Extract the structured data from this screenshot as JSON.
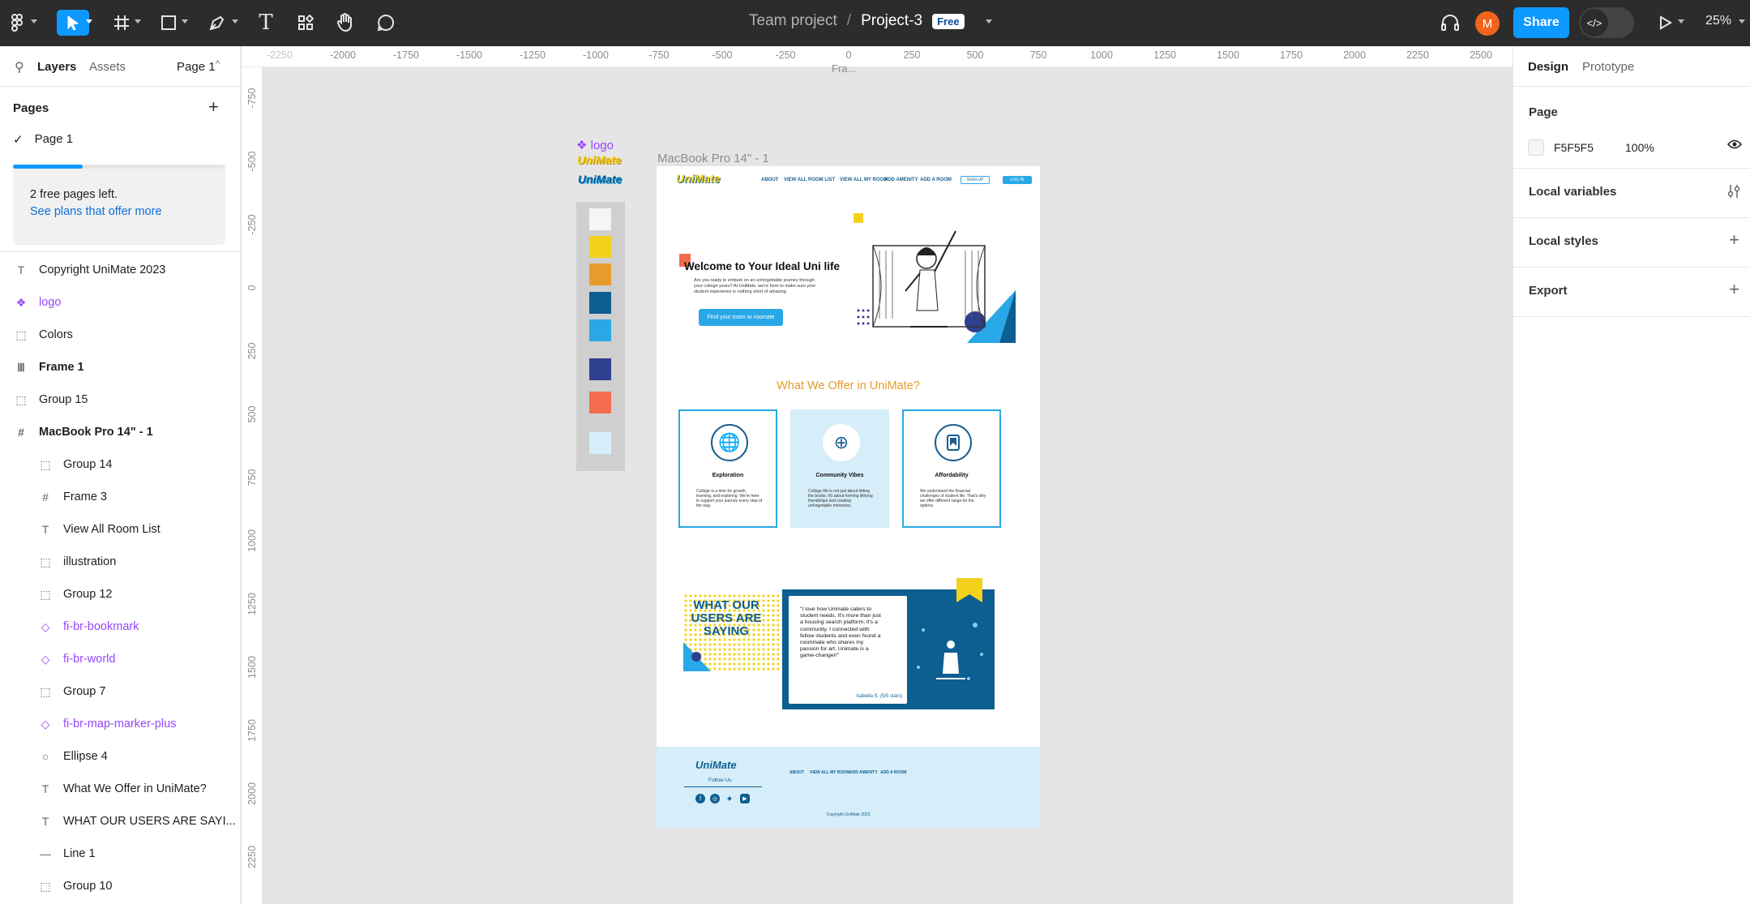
{
  "toolbar": {
    "team": "Team project",
    "separator": "/",
    "project": "Project-3",
    "badge": "Free",
    "share": "Share",
    "avatar_initial": "M",
    "zoom": "25%",
    "dev_mode_icon": "</>"
  },
  "left_panel": {
    "tab_layers": "Layers",
    "tab_assets": "Assets",
    "page_selector": "Page 1",
    "pages_heading": "Pages",
    "current_page": "Page 1",
    "free_pages_progress": 0.33,
    "free_pages_text": "2 free pages left.",
    "plans_link": "See plans that offer more",
    "layers": [
      {
        "name": "Copyright UniMate 2023",
        "icon": "T",
        "kind": "text"
      },
      {
        "name": "logo",
        "icon": "❖",
        "kind": "component"
      },
      {
        "name": "Colors",
        "icon": "⬚",
        "kind": "group"
      },
      {
        "name": "Frame 1",
        "icon": "Ⅲ",
        "kind": "frame"
      },
      {
        "name": "Group 15",
        "icon": "⬚",
        "kind": "group"
      },
      {
        "name": "MacBook Pro 14\" - 1",
        "icon": "#",
        "kind": "frame"
      },
      {
        "name": "Group 14",
        "icon": "⬚",
        "kind": "child-group"
      },
      {
        "name": "Frame 3",
        "icon": "#",
        "kind": "child-group"
      },
      {
        "name": "View All Room List",
        "icon": "T",
        "kind": "child-group"
      },
      {
        "name": "illustration",
        "icon": "⬚",
        "kind": "child-group"
      },
      {
        "name": "Group 12",
        "icon": "⬚",
        "kind": "child-group"
      },
      {
        "name": "fi-br-bookmark",
        "icon": "◇",
        "kind": "child-component"
      },
      {
        "name": "fi-br-world",
        "icon": "◇",
        "kind": "child-component"
      },
      {
        "name": "Group 7",
        "icon": "⬚",
        "kind": "child-group"
      },
      {
        "name": "fi-br-map-marker-plus",
        "icon": "◇",
        "kind": "child-component"
      },
      {
        "name": "Ellipse 4",
        "icon": "○",
        "kind": "child-group"
      },
      {
        "name": "What We Offer in UniMate?",
        "icon": "T",
        "kind": "child-group"
      },
      {
        "name": "WHAT OUR USERS ARE SAYI...",
        "icon": "T",
        "kind": "child-group"
      },
      {
        "name": "Line 1",
        "icon": "—",
        "kind": "child-group"
      },
      {
        "name": "Group 10",
        "icon": "⬚",
        "kind": "child-group"
      }
    ]
  },
  "rulers": {
    "horizontal": [
      "-2250",
      "-2000",
      "-1750",
      "-1500",
      "-1250",
      "-1000",
      "-750",
      "-500",
      "-250",
      "0",
      "250",
      "500",
      "750",
      "1000",
      "1250",
      "1500",
      "1750",
      "2000",
      "2250",
      "2500"
    ],
    "vertical": [
      "-750",
      "-500",
      "-250",
      "0",
      "250",
      "500",
      "750",
      "1000",
      "1250",
      "1500",
      "1750",
      "2000",
      "2250"
    ]
  },
  "right_panel": {
    "tab_design": "Design",
    "tab_prototype": "Prototype",
    "page_heading": "Page",
    "page_color": "F5F5F5",
    "page_opacity": "100%",
    "local_variables": "Local variables",
    "local_styles": "Local styles",
    "export": "Export"
  },
  "canvas": {
    "top_frame_label": "Fra...",
    "logo_component_label": "❖ logo",
    "logo_text": "UniMate",
    "frame_label": "MacBook Pro 14\" - 1",
    "swatches": [
      "#f5f5f5",
      "#f3d21c",
      "#e89a2b",
      "#0d5e91",
      "#29a8e8",
      "#2f3f8f",
      "#f36c4f",
      "#d6eef9"
    ],
    "site": {
      "logo": "UniMate",
      "nav": [
        "ABOUT",
        "VIEW ALL ROOM LIST",
        "VIEW ALL MY ROOM",
        "ADD AMENITY",
        "ADD A ROOM"
      ],
      "signup": "SIGN UP",
      "login": "LOG IN",
      "hero_title": "Welcome to Your Ideal Uni life",
      "hero_sub": "Are you ready to embark on an unforgettable journey through your college years? At UniMate, we're here to make sure your student experience is nothing short of amazing.",
      "hero_button": "Find your room or roomate",
      "offer_title": "What We Offer in UniMate?",
      "cards": [
        {
          "title": "Exploration",
          "body": "College is a time for growth, learning, and exploring. We're here to support your journey every step of the way.",
          "icon": "world-icon"
        },
        {
          "title": "Community Vibes",
          "body": "College life is not just about hitting the books; it's about forming lifelong friendships and creating unforgettable memories.",
          "icon": "map-marker-plus-icon"
        },
        {
          "title": "Affordability",
          "body": "We understand the financial challenges of student life. That's why we offer different range for the options.",
          "icon": "bookmark-icon"
        }
      ],
      "users_saying": "WHAT OUR USERS ARE SAYING",
      "quote": "\"I love how Unimate caters to student needs. It's more than just a housing search platform; it's a community. I connected with fellow students and even found a roommate who shares my passion for art. Unimate is a game-changer!\"",
      "quote_author": "Isabella S. (5/5 stars)",
      "footer_logo": "UniMate",
      "follow_us": "Follow Us",
      "footer_links": [
        "ABOUT",
        "VIEW ALL MY ROOM",
        "ADD AMENITY",
        "ADD A ROOM"
      ],
      "copyright": "Copyright UniMate 2023"
    }
  }
}
